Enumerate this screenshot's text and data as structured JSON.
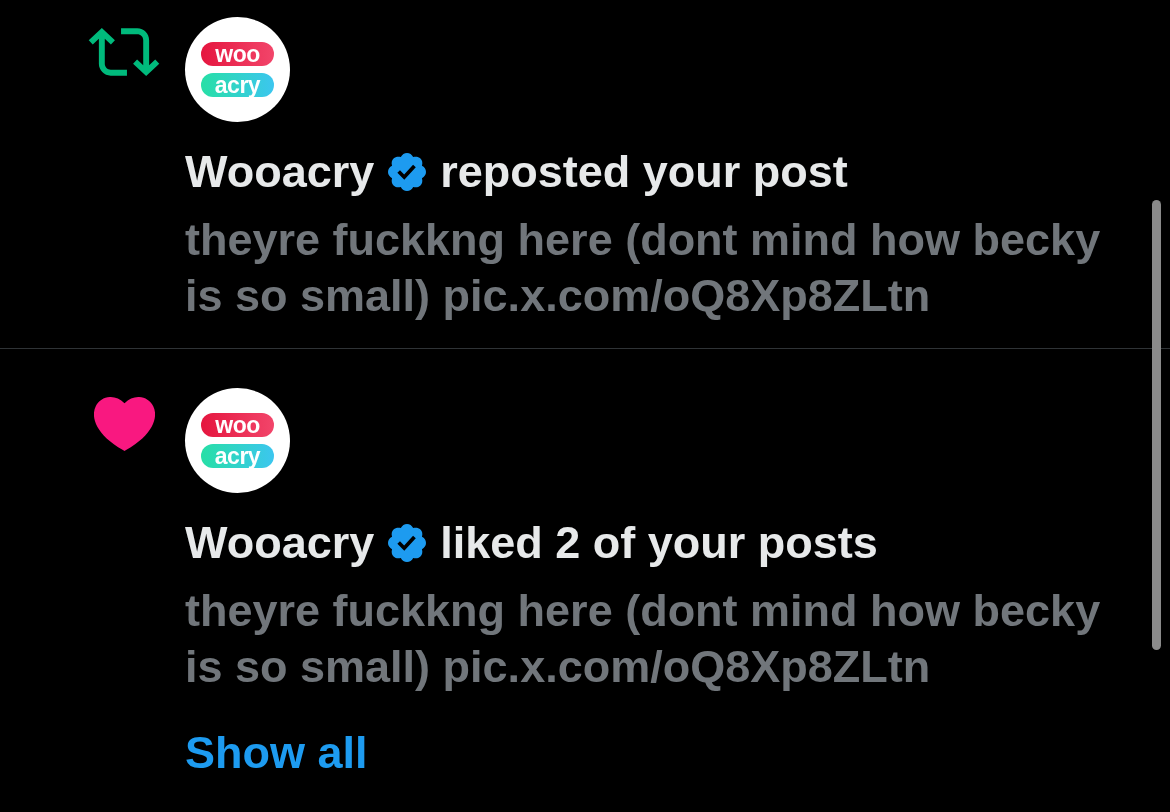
{
  "notifications": [
    {
      "kind": "repost",
      "user": {
        "name": "Wooacry",
        "verified": true,
        "avatar_logo": [
          "woo",
          "acry"
        ]
      },
      "action": "reposted your post",
      "post_text": "theyre fuckkng here (dont mind how becky is so small) pic.x.com/oQ8Xp8ZLtn"
    },
    {
      "kind": "like",
      "user": {
        "name": "Wooacry",
        "verified": true,
        "avatar_logo": [
          "woo",
          "acry"
        ]
      },
      "action": "liked 2 of your posts",
      "post_text": "theyre fuckkng here (dont mind how becky is so small) pic.x.com/oQ8Xp8ZLtn",
      "show_all": "Show all"
    }
  ]
}
